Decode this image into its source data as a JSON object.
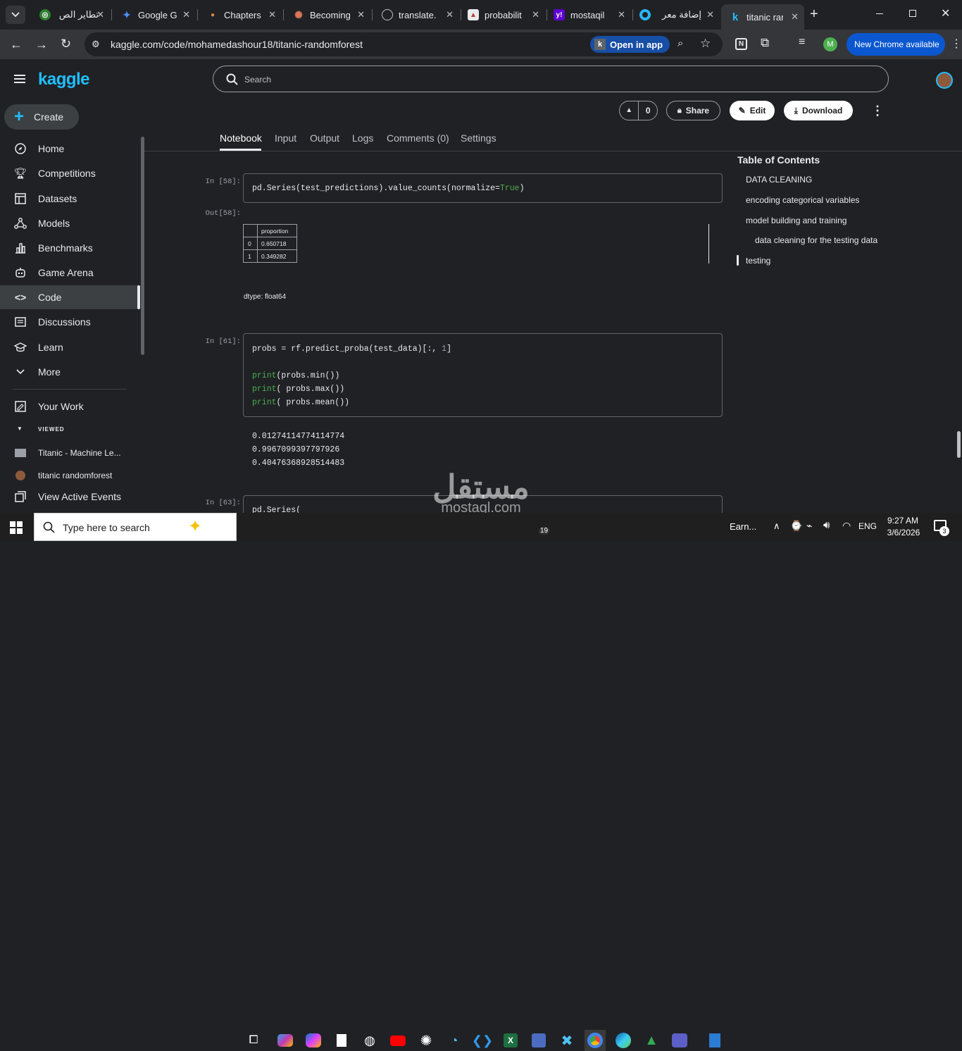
{
  "browser": {
    "tabs": [
      {
        "title": "تطاير الص",
        "favicon": "globe-green-icon"
      },
      {
        "title": "Google Gi",
        "favicon": "gemini-icon"
      },
      {
        "title": "Chapters",
        "favicon": "chapters-icon"
      },
      {
        "title": "Becoming",
        "favicon": "claude-icon"
      },
      {
        "title": "translate.",
        "favicon": "globe-icon"
      },
      {
        "title": "probabilit",
        "favicon": "book-icon"
      },
      {
        "title": "mostaqil",
        "favicon": "yahoo-icon"
      },
      {
        "title": "إضافة معر",
        "favicon": "circle-icon"
      },
      {
        "title": "titanic ran",
        "favicon": "kaggle-icon"
      }
    ],
    "url": "kaggle.com/code/mohamedashour18/titanic-randomforest",
    "open_in_app": "Open in app",
    "new_chrome": "New Chrome available",
    "profile_initial": "M"
  },
  "kaggle": {
    "logo": "kaggle",
    "create": "Create",
    "search_placeholder": "Search",
    "nav": [
      {
        "label": "Home",
        "icon": "compass-icon"
      },
      {
        "label": "Competitions",
        "icon": "trophy-icon"
      },
      {
        "label": "Datasets",
        "icon": "table-icon"
      },
      {
        "label": "Models",
        "icon": "models-icon"
      },
      {
        "label": "Benchmarks",
        "icon": "chart-icon"
      },
      {
        "label": "Game Arena",
        "icon": "robot-icon"
      },
      {
        "label": "Code",
        "icon": "code-icon"
      },
      {
        "label": "Discussions",
        "icon": "discussion-icon"
      },
      {
        "label": "Learn",
        "icon": "school-icon"
      },
      {
        "label": "More",
        "icon": "chevron-down-icon"
      }
    ],
    "your_work": "Your Work",
    "viewed": "VIEWED",
    "viewed_items": [
      "Titanic - Machine Le...",
      "titanic randomforest"
    ],
    "view_active_events": "View Active Events",
    "vote_count": "0",
    "share": "Share",
    "edit": "Edit",
    "download": "Download",
    "tabs": [
      "Notebook",
      "Input",
      "Output",
      "Logs",
      "Comments (0)",
      "Settings"
    ],
    "toc_title": "Table of Contents",
    "toc": [
      "DATA CLEANING",
      "encoding categorical variables",
      "model building and training",
      "data cleaning for the testing data",
      "testing"
    ]
  },
  "notebook": {
    "cell58_in": "In [58]:",
    "cell58_code": "pd.Series(test_predictions).value_counts(normalize=",
    "cell58_code_kw": "True",
    "cell58_code_end": ")",
    "cell58_out": "Out[58]:",
    "table_header": "proportion",
    "table_rows": [
      [
        "0",
        "0.650718"
      ],
      [
        "1",
        "0.349282"
      ]
    ],
    "dtype": "dtype: float64",
    "cell61_in": "In [61]:",
    "cell61_line1": "probs = rf.predict_proba(test_data)[:, ",
    "cell61_line1_num": "1",
    "cell61_line1_end": "]",
    "cell61_print": "print",
    "cell61_l2": "(probs.min())",
    "cell61_l3": "( probs.max())",
    "cell61_l4": "( probs.mean())",
    "outputs": [
      "0.01274114774114774",
      "0.9967099397797926",
      "0.40476368928514483"
    ],
    "cell63_in": "In [63]:",
    "cell63_code": "pd.Series("
  },
  "watermark": {
    "arabic": "مستقل",
    "latin": "mostaql.com"
  },
  "taskbar": {
    "search_placeholder": "Type here to search",
    "earn": "Earn...",
    "lang": "ENG",
    "time": "9:27 AM",
    "date": "3/6/2026",
    "notif_count": "3",
    "badge_19": "19"
  },
  "colors": {
    "kaggle_blue": "#20beff",
    "chrome_blue": "#8ab4f8",
    "accent_green": "#4caf50"
  }
}
